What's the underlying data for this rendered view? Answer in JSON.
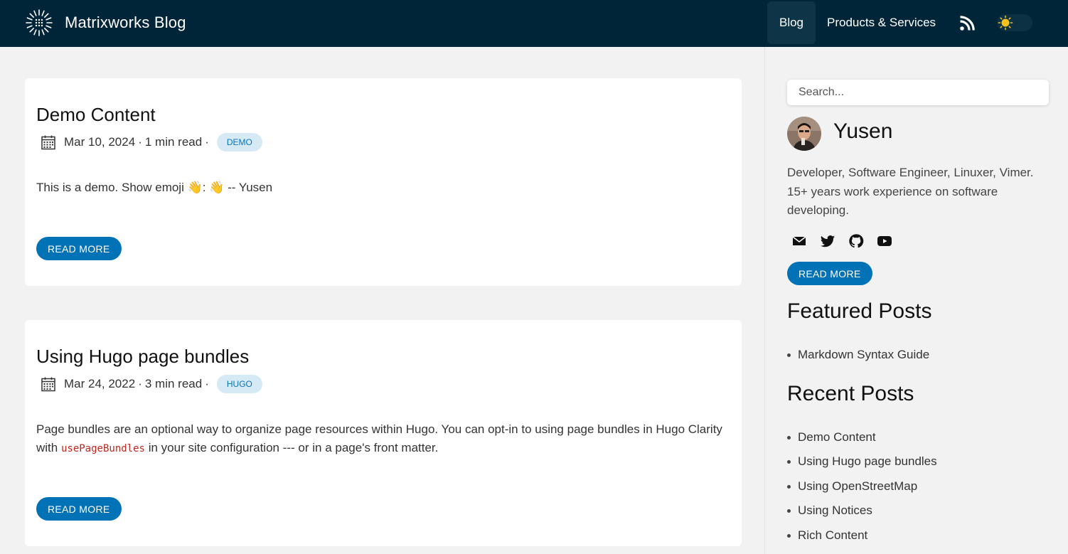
{
  "header": {
    "brand": "Matrixworks Blog",
    "nav": {
      "blog": "Blog",
      "products": "Products & Services"
    },
    "colors": {
      "bar": "#002538",
      "accent": "#0072b5"
    },
    "icons": [
      "logo-icon",
      "rss-icon",
      "sun-icon"
    ]
  },
  "posts": [
    {
      "title": "Demo Content",
      "date": "Mar 10, 2024",
      "read_time": "1 min read",
      "sep": "·",
      "tag": "DEMO",
      "excerpt": "This is a demo. Show emoji 👋: 👋 -- Yusen",
      "button": "READ MORE"
    },
    {
      "title": "Using Hugo page bundles",
      "date": "Mar 24, 2022",
      "read_time": "3 min read",
      "sep": "·",
      "tag": "HUGO",
      "excerpt_before": "Page bundles are an optional way to organize page resources within Hugo. You can opt-in to using page bundles in Hugo Clarity with ",
      "excerpt_code": "usePageBundles",
      "excerpt_after": " in your site configuration --- or in a page's front matter.",
      "button": "READ MORE"
    }
  ],
  "sidebar": {
    "search_placeholder": "Search...",
    "author": "Yusen",
    "bio": "Developer, Software Engineer, Linuxer, Vimer. 15+ years work experience on software developing.",
    "social_icons": [
      "email-icon",
      "twitter-icon",
      "github-icon",
      "youtube-icon"
    ],
    "button": "READ MORE",
    "featured_heading": "Featured Posts",
    "featured": [
      "Markdown Syntax Guide"
    ],
    "recent_heading": "Recent Posts",
    "recent": [
      "Demo Content",
      "Using Hugo page bundles",
      "Using OpenStreetMap",
      "Using Notices",
      "Rich Content"
    ]
  }
}
